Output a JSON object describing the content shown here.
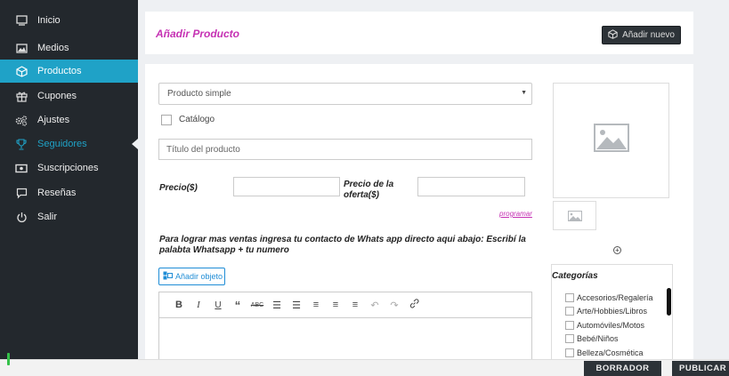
{
  "sidebar": {
    "items": [
      {
        "label": "Inicio",
        "icon": "monitor-icon"
      },
      {
        "label": "Medios",
        "icon": "image-icon"
      },
      {
        "label": "Productos",
        "icon": "cube-icon"
      },
      {
        "label": "Cupones",
        "icon": "gift-icon"
      },
      {
        "label": "Ajustes",
        "icon": "gears-icon"
      },
      {
        "label": "Seguidores",
        "icon": "trophy-icon"
      },
      {
        "label": "Suscripciones",
        "icon": "money-icon"
      },
      {
        "label": "Reseñas",
        "icon": "comment-icon"
      },
      {
        "label": "Salir",
        "icon": "power-icon"
      }
    ]
  },
  "header": {
    "title": "Añadir Producto",
    "add_new_label": "Añadir nuevo"
  },
  "form": {
    "product_type": "Producto simple",
    "catalog_label": "Catálogo",
    "title_placeholder": "Título del producto",
    "price_label": "Precio($)",
    "sale_price_label": "Precio de la oferta($)",
    "schedule_link": "programar",
    "whatsapp_note": "Para lograr mas ventas ingresa tu contacto de Whats app directo aqui abajo: Escribí la palabta Whatsapp + tu numero",
    "add_object_label": "Añadir objeto"
  },
  "categories": {
    "title": "Categorías",
    "items": [
      "Accesorios/Regalería",
      "Arte/Hobbies/Libros",
      "Automóviles/Motos",
      "Bebé/Niños",
      "Belleza/Cosmética"
    ]
  },
  "actions": {
    "draft_label": "BORRADOR",
    "publish_label": "PUBLICAR"
  },
  "colors": {
    "accent": "#1fa2c7",
    "title": "#c531b3",
    "sidebar_bg": "#23282d"
  }
}
